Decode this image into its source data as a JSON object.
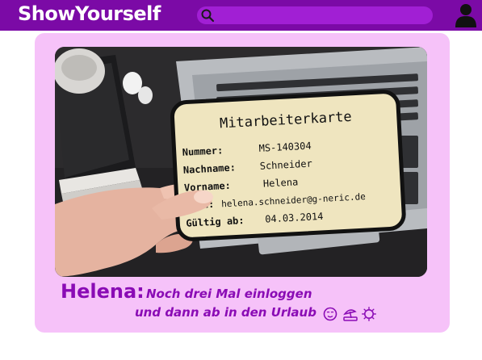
{
  "app": {
    "brand": "ShowYourself",
    "search_placeholder": "",
    "colors": {
      "bar": "#7b0aa6",
      "search": "#a11fd4",
      "card": "#f6c2f9",
      "accent": "#8a0bb5"
    }
  },
  "post": {
    "image": {
      "card_title": "Mitarbeiterkarte",
      "rows": [
        {
          "label": "Nummer:",
          "value": "MS-140304"
        },
        {
          "label": "Nachname:",
          "value": "Schneider"
        },
        {
          "label": "Vorname:",
          "value": "Helena"
        },
        {
          "label": "Mail:",
          "value": "helena.schneider@g-neric.de"
        },
        {
          "label": "Gültig ab:",
          "value": "04.03.2014"
        }
      ]
    },
    "author": "Helena:",
    "text_line1": "Noch drei Mal einloggen",
    "text_line2": "und dann ab in den Urlaub",
    "emoji_icons": [
      "relieved-face-icon",
      "beach-umbrella-icon",
      "sun-icon"
    ]
  }
}
